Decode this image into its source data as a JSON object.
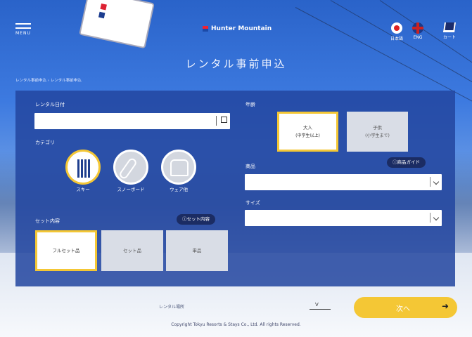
{
  "header": {
    "menu_label": "MENU",
    "logo": "Hunter Mountain",
    "lang_ja": "日本語",
    "lang_en": "ENG",
    "cart_label": "カート"
  },
  "title": "レンタル事前申込",
  "breadcrumb": "レンタル事前申込 › レンタル事前申込",
  "form": {
    "rental_date_label": "レンタル日付",
    "rental_date_value": "",
    "category_label": "カテゴリ",
    "categories": [
      {
        "label": "スキー",
        "icon": "ski-icon",
        "active": true
      },
      {
        "label": "スノーボード",
        "icon": "snowboard-icon",
        "active": false
      },
      {
        "label": "ウェア他",
        "icon": "wear-icon",
        "active": false
      }
    ],
    "set_label": "セット内容",
    "set_button": "ⓘセット内容",
    "set_options": [
      {
        "label": "フルセット品",
        "active": true
      },
      {
        "label": "セット品",
        "active": false
      },
      {
        "label": "単品",
        "active": false
      }
    ],
    "age_label": "年齢",
    "age_options": [
      {
        "label": "大人",
        "sub": "(中学生以上)",
        "active": true
      },
      {
        "label": "子供",
        "sub": "(小学生まで)",
        "active": false
      }
    ],
    "product_label": "商品",
    "product_guide": "ⓘ商品ガイド",
    "product_value": "",
    "size_label": "サイズ",
    "size_value": ""
  },
  "footer": {
    "shop_label": "レンタル場所",
    "shop_value": "V",
    "next_label": "次へ",
    "copyright": "Copyright Tokyu Resorts & Stays Co., Ltd. All rights Reserved."
  },
  "colors": {
    "accent": "#f4c735",
    "panel": "#2346a0",
    "dark": "#1b2c63"
  }
}
